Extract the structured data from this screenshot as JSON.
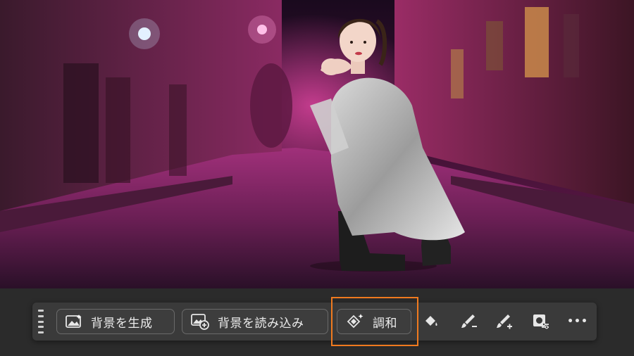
{
  "canvas": {
    "description_icon": "image-canvas"
  },
  "toolbar": {
    "generate_background_label": "背景を生成",
    "load_background_label": "背景を読み込み",
    "harmonize_label": "調和",
    "more_label": "•••"
  },
  "colors": {
    "toolbar_bg": "#3a3a3a",
    "highlight": "#f07a1f",
    "text": "#ececec"
  }
}
